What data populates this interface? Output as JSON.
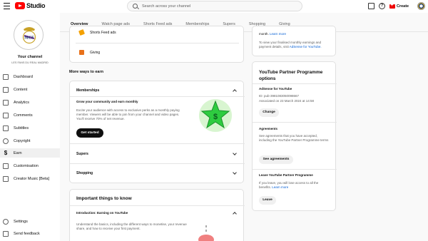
{
  "app": {
    "logo_text": "Studio",
    "search_placeholder": "Search across your channel",
    "create_label": "Create"
  },
  "channel": {
    "title": "Your channel",
    "name": "LES FANS DU REAL MADRID"
  },
  "sidebar": {
    "items": [
      {
        "label": "Dashboard",
        "icon": "dashboard-icon"
      },
      {
        "label": "Content",
        "icon": "content-icon"
      },
      {
        "label": "Analytics",
        "icon": "analytics-icon"
      },
      {
        "label": "Comments",
        "icon": "comments-icon"
      },
      {
        "label": "Subtitles",
        "icon": "subtitles-icon"
      },
      {
        "label": "Copyright",
        "icon": "copyright-icon"
      },
      {
        "label": "Earn",
        "icon": "dollar-icon",
        "active": true
      },
      {
        "label": "Customisation",
        "icon": "customisation-icon"
      },
      {
        "label": "Creator Music [Beta]",
        "icon": "music-icon"
      }
    ],
    "bottom": [
      {
        "label": "Settings",
        "icon": "gear-icon"
      },
      {
        "label": "Send feedback",
        "icon": "feedback-icon"
      }
    ]
  },
  "tabs": [
    "Overview",
    "Watch page ads",
    "Shorts Feed ads",
    "Memberships",
    "Supers",
    "Shopping",
    "Giving"
  ],
  "left": {
    "shorts_row": "Shorts Feed ads",
    "giving_row": "Giving",
    "more_ways_heading": "More ways to earn",
    "memberships": {
      "title": "Memberships",
      "subtitle": "Grow your community and earn monthly",
      "body": "Excite your audience with access to exclusive perks as a monthly paying member. Viewers will be able to join from your channel and video pages. You'll receive 70% of net revenue.",
      "button": "Get started"
    },
    "supers": "Supers",
    "shopping": "Shopping",
    "important": {
      "title": "Important things to know",
      "item_title": "Introduction: Earning on YouTube",
      "item_body": "Understand the basics, including the different ways to monetise, your revenue share, and how to receive your first payment."
    }
  },
  "right": {
    "top_text_1": "month.",
    "top_link": "Learn more",
    "top_text_2": "To view your finalised monthly earnings and payment details, visit",
    "top_link_2": "AdSense for YouTube.",
    "ypp": {
      "title": "YouTube Partner Programme options",
      "adsense_heading": "AdSense for YouTube",
      "id_line": "ID: pub-3981083050098667",
      "assoc_line": "Associated on 23 March 2024 at 14:58",
      "change_button": "Change",
      "agreements_heading": "Agreements",
      "agreements_body": "See agreements that you have accepted, including the YouTube Partner Programme terms",
      "see_agreements_button": "See agreements",
      "leave_heading": "Leave YouTube Partner Programme",
      "leave_body": "If you leave, you will lose access to all the benefits.",
      "leave_link": "Learn more",
      "leave_button": "Leave"
    }
  },
  "colors": {
    "brand_red": "#ff0000",
    "link": "#065fd4",
    "star_green": "#2ecc40"
  }
}
